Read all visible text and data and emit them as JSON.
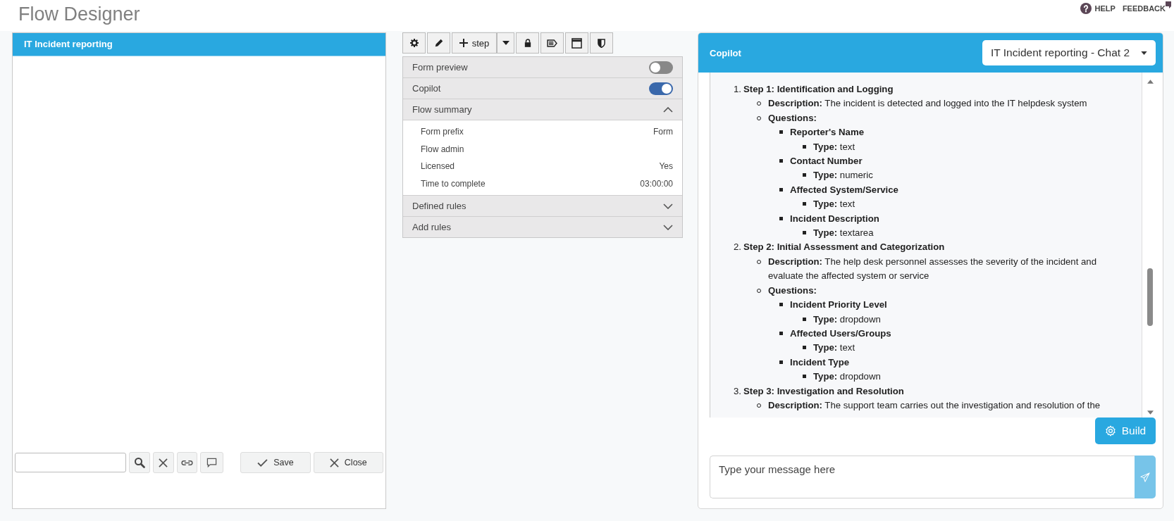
{
  "app_title": "Flow Designer",
  "top_links": [
    {
      "kind": "help",
      "label": "HELP"
    },
    {
      "kind": "feedback",
      "label": "FEEDBACK"
    }
  ],
  "flow_panel": {
    "title": "IT Incident reporting",
    "buttons": [
      {
        "kind": "save",
        "label": "Save"
      },
      {
        "kind": "close",
        "label": "Close"
      }
    ]
  },
  "toolbar": {
    "step_label": "step"
  },
  "settings": {
    "toggles": [
      {
        "label": "Form preview",
        "on": false
      },
      {
        "label": "Copilot",
        "on": true
      }
    ],
    "sections": [
      {
        "label": "Flow summary",
        "expanded": true,
        "rows": [
          {
            "label": "Form prefix",
            "value": "Form"
          },
          {
            "label": "Flow admin"
          },
          {
            "label": "Licensed",
            "value": "Yes"
          },
          {
            "label": "Time to complete",
            "value": "03:00:00"
          }
        ]
      },
      {
        "label": "Defined rules",
        "expanded": false
      },
      {
        "label": "Add rules",
        "expanded": false
      }
    ]
  },
  "copilot": {
    "title": "Copilot",
    "chat_select": "IT Incident reporting - Chat 2",
    "steps": [
      {
        "number": "1.",
        "title": "Step 1: Identification and Logging",
        "items": [
          {
            "text": "**Description:** The incident is detected and logged into the IT helpdesk system"
          },
          {
            "text": "**Questions:**",
            "children": [
              {
                "text": "Reporter's Name",
                "children": [
                  {
                    "text": "**Type:** text"
                  }
                ]
              },
              {
                "text": "Contact Number",
                "children": [
                  {
                    "text": "**Type:** numeric"
                  }
                ]
              },
              {
                "text": "Affected System/Service",
                "children": [
                  {
                    "text": "**Type:** text"
                  }
                ]
              },
              {
                "text": "Incident Description",
                "children": [
                  {
                    "text": "**Type:** textarea"
                  }
                ]
              }
            ]
          }
        ]
      },
      {
        "number": "2.",
        "title": "Step 2: Initial Assessment and Categorization",
        "items": [
          {
            "text": "**Description:** The help desk personnel assesses the severity of the incident and evaluate the affected system or service"
          },
          {
            "text": "**Questions:**",
            "children": [
              {
                "text": "Incident Priority Level",
                "children": [
                  {
                    "text": "**Type:** dropdown"
                  }
                ]
              },
              {
                "text": "Affected Users/Groups",
                "children": [
                  {
                    "text": "**Type:** text"
                  }
                ]
              },
              {
                "text": "Incident Type",
                "children": [
                  {
                    "text": "**Type:** dropdown"
                  }
                ]
              }
            ]
          }
        ]
      },
      {
        "number": "3.",
        "title": "Step 3: Investigation and Resolution",
        "items": [
          {
            "text": "**Description:** The support team carries out the investigation and resolution of the"
          }
        ]
      }
    ],
    "build_label": "Build",
    "message": {
      "placeholder": "Type your message here"
    }
  }
}
